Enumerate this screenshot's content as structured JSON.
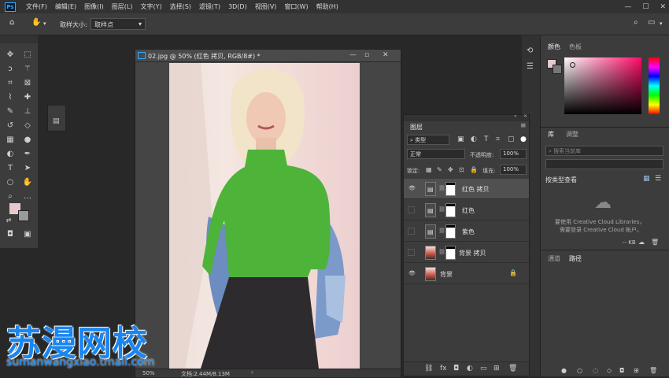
{
  "menubar": {
    "logo": "Ps",
    "items": [
      "文件(F)",
      "编辑(E)",
      "图像(I)",
      "图层(L)",
      "文字(Y)",
      "选择(S)",
      "滤镜(T)",
      "3D(D)",
      "视图(V)",
      "窗口(W)",
      "帮助(H)"
    ],
    "window_controls": [
      "—",
      "☐",
      "✕"
    ]
  },
  "optionsbar": {
    "sample_size_label": "取样大小:",
    "sample_size_value": "取样点"
  },
  "document": {
    "title": "02.jpg @ 50% (红色 拷贝, RGB/8#) *",
    "zoom": "50%",
    "doc_size": "文档:2.44M/8.13M"
  },
  "color_panel": {
    "tabs": [
      "颜色",
      "色板"
    ]
  },
  "library_panel": {
    "tabs": [
      "库",
      "调整"
    ],
    "search_placeholder": "搜索当前库",
    "view_label": "按类型查看",
    "message_line1": "要使用 Creative Cloud Libraries，",
    "message_line2": "需要登录 Creative Cloud 帐户。",
    "size": "-- KB"
  },
  "bottom_panel": {
    "tabs": [
      "通道",
      "路径"
    ]
  },
  "layers_panel": {
    "tab": "图层",
    "filter_value": "类型",
    "blend_mode": "正常",
    "opacity_label": "不透明度:",
    "opacity_value": "100%",
    "lock_label": "锁定:",
    "fill_label": "填充:",
    "fill_value": "100%",
    "layers": [
      {
        "name": "红色 拷贝",
        "visible": true,
        "selected": true,
        "type": "adjustment"
      },
      {
        "name": "红色",
        "visible": false,
        "selected": false,
        "type": "adjustment"
      },
      {
        "name": "紫色",
        "visible": false,
        "selected": false,
        "type": "adjustment"
      },
      {
        "name": "背景 拷贝",
        "visible": false,
        "selected": false,
        "type": "photo-masked"
      },
      {
        "name": "背景",
        "visible": true,
        "selected": false,
        "type": "photo-locked"
      }
    ]
  },
  "watermark": {
    "name": "苏漫网校",
    "url": "sumanwangxiao.tmall.com"
  },
  "colors": {
    "foreground": "#e8c9cc",
    "background": "#9a9a9a",
    "sweater": "#4db339",
    "accent_ps": "#31a8ff",
    "watermark": "#1a86f0"
  }
}
